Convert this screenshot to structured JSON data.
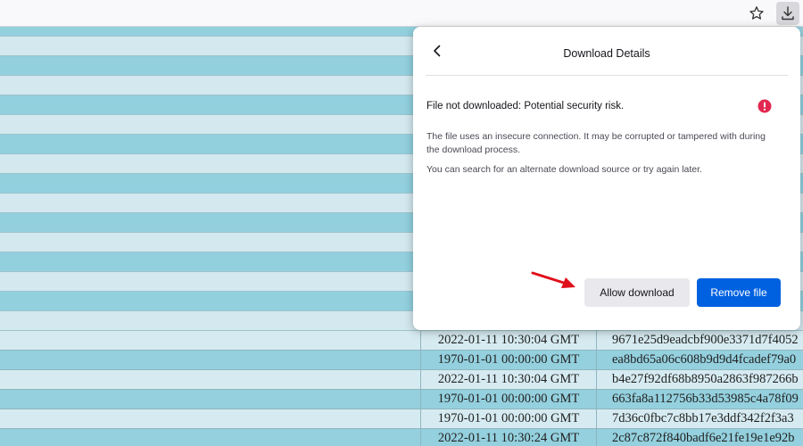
{
  "toolbar": {
    "icons": [
      "star-icon",
      "download-icon"
    ]
  },
  "panel": {
    "title": "Download Details",
    "status": "File not downloaded: Potential security risk.",
    "description1": "The file uses an insecure connection. It may be corrupted or tampered with during the download process.",
    "description2": "You can search for an alternate download source or try again later.",
    "allow_label": "Allow download",
    "remove_label": "Remove file",
    "colors": {
      "accent": "#0061e0",
      "warning": "#e22850",
      "annotation_arrow": "#e0101a"
    }
  },
  "table": {
    "rows": [
      {
        "date": "2022-01-11 10:30:04 GMT",
        "hash": "9671e25d9eadcbf900e3371d7f4052"
      },
      {
        "date": "1970-01-01 00:00:00 GMT",
        "hash": "ea8bd65a06c608b9d9d4fcadef79a0"
      },
      {
        "date": "2022-01-11 10:30:04 GMT",
        "hash": "b4e27f92df68b8950a2863f987266b"
      },
      {
        "date": "1970-01-01 00:00:00 GMT",
        "hash": "663fa8a112756b33d53985c4a78f09"
      },
      {
        "date": "1970-01-01 00:00:00 GMT",
        "hash": "7d36c0fbc7c8bb17e3ddf342f2f3a3"
      },
      {
        "date": "2022-01-11 10:30:24 GMT",
        "hash": "2c87c872f840badf6e21fe19e1e92b"
      }
    ]
  }
}
